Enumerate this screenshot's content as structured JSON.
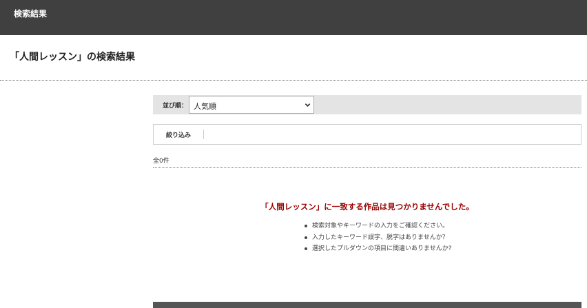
{
  "header": {
    "title": "検索結果"
  },
  "page": {
    "heading": "「人間レッスン」の検索結果"
  },
  "sort": {
    "label": "並び順：",
    "selected": "人気順"
  },
  "filter": {
    "label": "絞り込み"
  },
  "results": {
    "count": "全0件",
    "no_result_message": "「人間レッスン」に一致する作品は見つかりませんでした。",
    "tips": [
      "検索対象やキーワードの入力をご確認ください。",
      "入力したキーワード誤字、脱字はありませんか？",
      "選択したプルダウンの項目に間違いありませんか?"
    ]
  }
}
